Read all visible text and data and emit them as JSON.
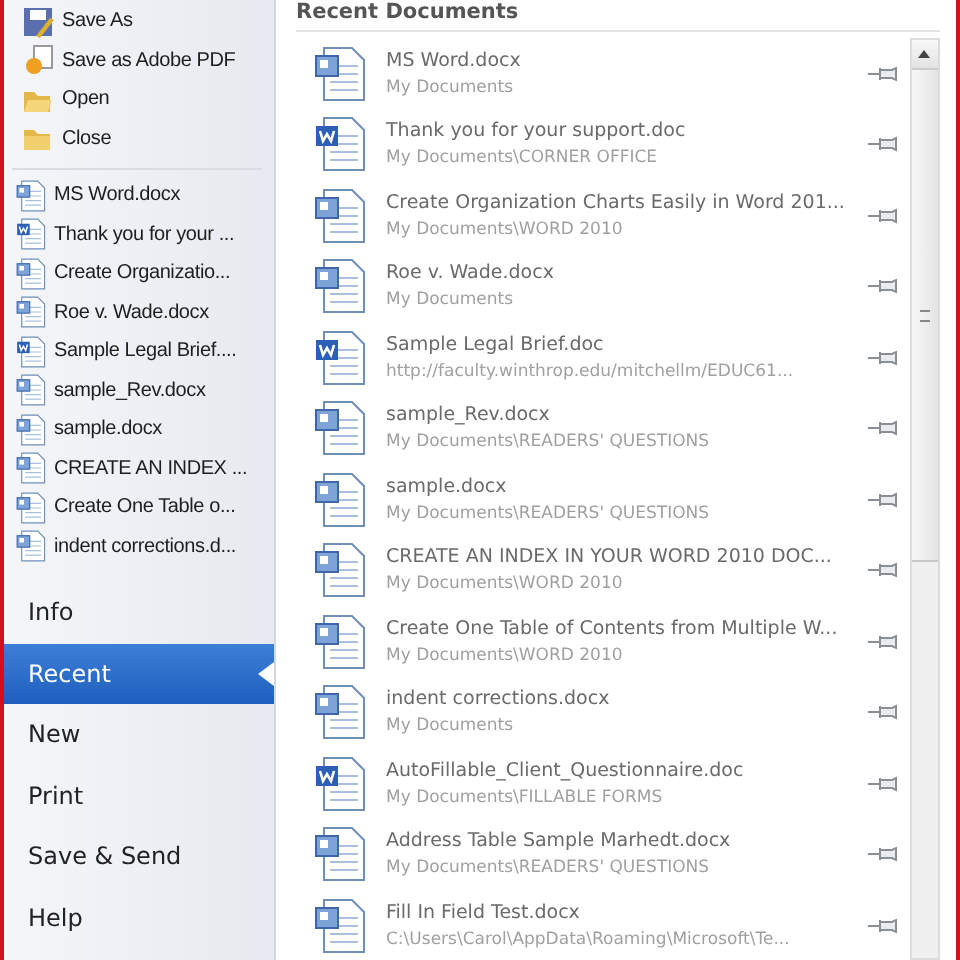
{
  "actions": [
    {
      "label": "Save As",
      "kind": "save-as"
    },
    {
      "label": "Save as Adobe PDF",
      "kind": "pdf"
    },
    {
      "label": "Open",
      "kind": "open"
    },
    {
      "label": "Close",
      "kind": "close"
    }
  ],
  "quick_files": [
    {
      "label": "MS Word.docx",
      "kind": "docx"
    },
    {
      "label": "Thank you for your ...",
      "kind": "doc"
    },
    {
      "label": "Create Organizatio...",
      "kind": "docx"
    },
    {
      "label": "Roe v. Wade.docx",
      "kind": "docx"
    },
    {
      "label": "Sample Legal Brief....",
      "kind": "doc"
    },
    {
      "label": "sample_Rev.docx",
      "kind": "docx"
    },
    {
      "label": "sample.docx",
      "kind": "docx"
    },
    {
      "label": "CREATE AN INDEX ...",
      "kind": "docx"
    },
    {
      "label": "Create One Table o...",
      "kind": "docx"
    },
    {
      "label": "indent corrections.d...",
      "kind": "docx"
    }
  ],
  "nav": [
    {
      "label": "Info",
      "selected": false
    },
    {
      "label": "Recent",
      "selected": true
    },
    {
      "label": "New",
      "selected": false
    },
    {
      "label": "Print",
      "selected": false
    },
    {
      "label": "Save & Send",
      "selected": false
    },
    {
      "label": "Help",
      "selected": false
    }
  ],
  "recent": {
    "title": "Recent Documents",
    "items": [
      {
        "name": "MS Word.docx",
        "path": "My Documents",
        "kind": "docx"
      },
      {
        "name": "Thank you for your support.doc",
        "path": "My Documents\\CORNER OFFICE",
        "kind": "doc"
      },
      {
        "name": "Create Organization Charts Easily in Word 201...",
        "path": "My Documents\\WORD 2010",
        "kind": "docx"
      },
      {
        "name": "Roe v. Wade.docx",
        "path": "My Documents",
        "kind": "docx"
      },
      {
        "name": "Sample Legal Brief.doc",
        "path": "http://faculty.winthrop.edu/mitchellm/EDUC61...",
        "kind": "doc"
      },
      {
        "name": "sample_Rev.docx",
        "path": "My Documents\\READERS' QUESTIONS",
        "kind": "docx"
      },
      {
        "name": "sample.docx",
        "path": "My Documents\\READERS' QUESTIONS",
        "kind": "docx"
      },
      {
        "name": "CREATE AN INDEX IN YOUR WORD 2010 DOC...",
        "path": "My Documents\\WORD 2010",
        "kind": "docx"
      },
      {
        "name": "Create One Table of Contents from Multiple W...",
        "path": "My Documents\\WORD 2010",
        "kind": "docx"
      },
      {
        "name": "indent corrections.docx",
        "path": "My Documents",
        "kind": "docx"
      },
      {
        "name": "AutoFillable_Client_Questionnaire.doc",
        "path": "My Documents\\FILLABLE FORMS",
        "kind": "doc"
      },
      {
        "name": "Address Table Sample Marhedt.docx",
        "path": "My Documents\\READERS' QUESTIONS",
        "kind": "docx"
      },
      {
        "name": "Fill In Field Test.docx",
        "path": "C:\\Users\\Carol\\AppData\\Roaming\\Microsoft\\Te...",
        "kind": "docx"
      }
    ]
  }
}
